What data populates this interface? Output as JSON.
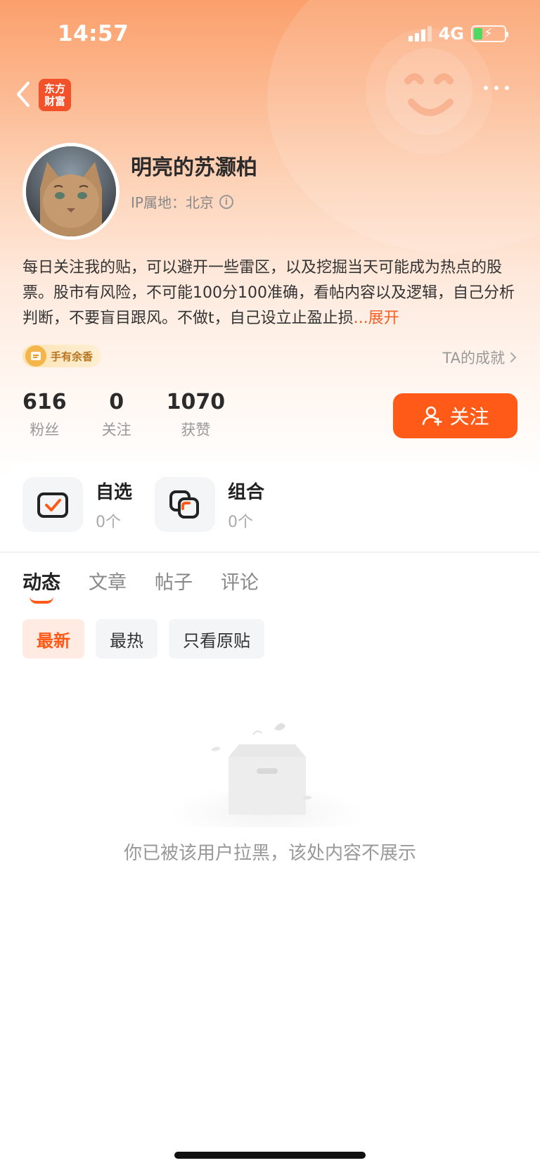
{
  "status_bar": {
    "time": "14:57",
    "network": "4G"
  },
  "app": {
    "logo_line1": "东方",
    "logo_line2": "财富"
  },
  "profile": {
    "username": "明亮的苏灏柏",
    "ip_location": "IP属地：北京",
    "bio": "每日关注我的贴，可以避开一些雷区，以及挖掘当天可能成为热点的股票。股市有风险，不可能100分100准确，看帖内容以及逻辑，自己分析判断，不要盲目跟风。不做t，自己设立止盈止损",
    "expand_label": "...展开",
    "badge_label": "手有余香",
    "achievement_link": "TA的成就",
    "stats": [
      {
        "value": "616",
        "label": "粉丝"
      },
      {
        "value": "0",
        "label": "关注"
      },
      {
        "value": "1070",
        "label": "获赞"
      }
    ],
    "follow_button": "关注"
  },
  "quick_links": [
    {
      "title": "自选",
      "count": "0个"
    },
    {
      "title": "组合",
      "count": "0个"
    }
  ],
  "tabs": [
    {
      "label": "动态",
      "active": true
    },
    {
      "label": "文章",
      "active": false
    },
    {
      "label": "帖子",
      "active": false
    },
    {
      "label": "评论",
      "active": false
    }
  ],
  "filters": [
    {
      "label": "最新",
      "active": true
    },
    {
      "label": "最热",
      "active": false
    },
    {
      "label": "只看原贴",
      "active": false
    }
  ],
  "empty_state": {
    "message": "你已被该用户拉黑，该处内容不展示"
  },
  "colors": {
    "accent": "#ff5a17",
    "brand_logo": "#f2512a"
  }
}
